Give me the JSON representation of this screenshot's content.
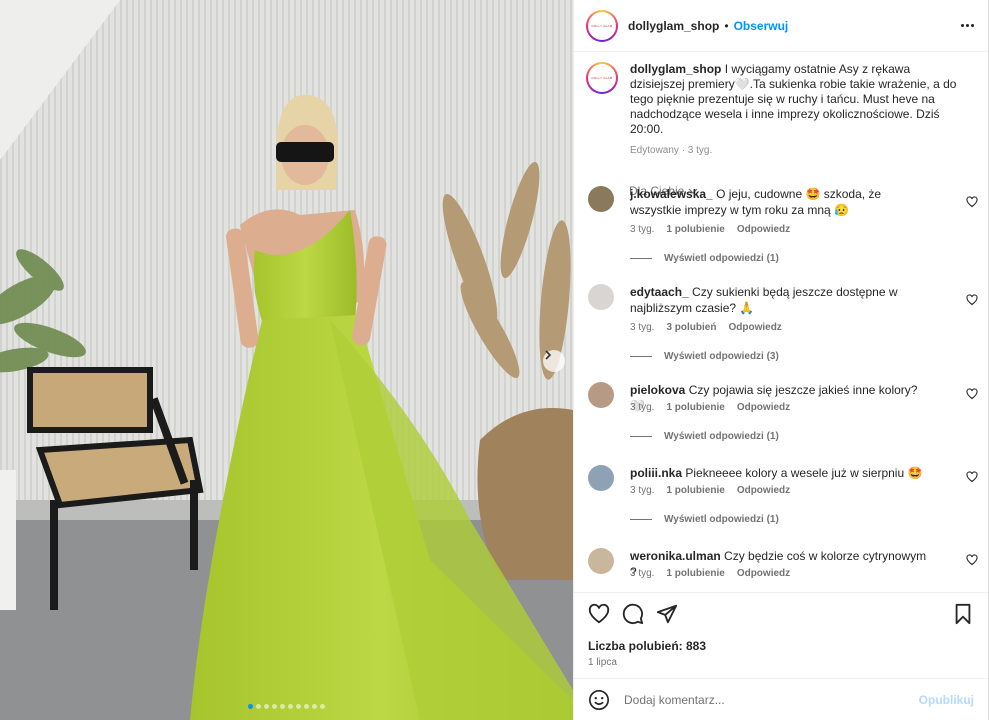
{
  "post": {
    "username": "dollyglam_shop",
    "separator": "•",
    "follow_label": "Obserwuj",
    "more_icon": "more-horizontal-icon",
    "avatar_text": "DOLLY GLAM"
  },
  "caption": {
    "username": "dollyglam_shop",
    "text": "I wyciągamy ostatnie Asy z rękawa dzisiejszej premiery🤍.Ta sukienka robie takie wrażenie, a do tego pięknie prezentuje się w ruchy i tańcu. Must heve na nadchodzące wesela i inne imprezy okolicznościowe. Dziś 20:00.",
    "meta": "Edytowany · 3 tyg."
  },
  "filter": {
    "label": "Dla Ciebie",
    "icon": "chevron-down-icon"
  },
  "comments": [
    {
      "username": "j.kowalewska_",
      "text": "O jeju, cudowne 🤩 szkoda, że wszystkie imprezy w tym roku za mną 😥",
      "time": "3 tyg.",
      "likes": "1 polubienie",
      "reply": "Odpowiedz",
      "view_replies": "Wyświetl odpowiedzi (1)",
      "avatar_color": "#8a7a5c"
    },
    {
      "username": "edytaach_",
      "text": "Czy sukienki będą jeszcze dostępne w najbliższym czasie? 🙏",
      "time": "3 tyg.",
      "likes": "3 polubień",
      "reply": "Odpowiedz",
      "view_replies": "Wyświetl odpowiedzi (3)",
      "avatar_color": "#d9d5d2"
    },
    {
      "username": "pielokova",
      "text": "Czy pojawia się jeszcze jakieś inne kolory? 🤍",
      "time": "3 tyg.",
      "likes": "1 polubienie",
      "reply": "Odpowiedz",
      "view_replies": "Wyświetl odpowiedzi (1)",
      "avatar_color": "#b79a86"
    },
    {
      "username": "poliii.nka",
      "text": "Piekneeee kolory a wesele już w sierpniu 🤩",
      "time": "3 tyg.",
      "likes": "1 polubienie",
      "reply": "Odpowiedz",
      "view_replies": "Wyświetl odpowiedzi (1)",
      "avatar_color": "#8fa2b5"
    },
    {
      "username": "weronika.ulman",
      "text": "Czy będzie coś w kolorze cytrynowym ?",
      "time": "3 tyg.",
      "likes": "1 polubienie",
      "reply": "Odpowiedz",
      "view_replies": "",
      "avatar_color": "#c8b79c"
    }
  ],
  "actions": {
    "like_icon": "heart-icon",
    "comment_icon": "comment-icon",
    "share_icon": "share-icon",
    "save_icon": "bookmark-icon",
    "likes_text": "Liczba polubień: 883",
    "date": "1 lipca"
  },
  "composer": {
    "emoji_icon": "emoji-icon",
    "placeholder": "Dodaj komentarz...",
    "post_label": "Opublikuj"
  },
  "carousel": {
    "next_icon": "chevron-right-icon",
    "total_slides": 10,
    "active_index": 0
  },
  "colors": {
    "accent": "#0095f6",
    "dress": "#b8d43a",
    "text_secondary": "#737373"
  }
}
